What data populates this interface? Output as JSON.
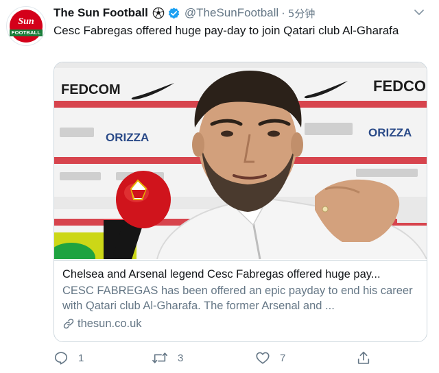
{
  "tweet": {
    "account": {
      "display_name": "The Sun Football",
      "emoji_icon": "soccer-ball-icon",
      "verified_icon": "verified-badge-icon",
      "handle": "@TheSunFootball",
      "separator": "·",
      "time": "5分钟",
      "avatar": {
        "logo_text": "Sun",
        "logo_subtext": "FOOTBALL",
        "brand_red": "#d4001a",
        "brand_green": "#1a7d3a"
      }
    },
    "text": "Cesc Fabregas offered huge pay-day to join Qatari club Al-Gharafa",
    "card": {
      "image_description_icon": "press-conference-photo",
      "title": "Chelsea and Arsenal legend Cesc Fabregas offered huge pay...",
      "description": "CESC FABREGAS has been offered an epic payday to end his career with Qatari club Al-Gharafa. The former Arsenal and ...",
      "domain": "thesun.co.uk",
      "sponsor_boards": [
        "FEDCOM",
        "FEDCO",
        "ORIZZA",
        "ORIZZA"
      ]
    },
    "actions": {
      "reply_count": "1",
      "retweet_count": "3",
      "like_count": "7"
    },
    "colors": {
      "text": "#14171a",
      "secondary": "#657786",
      "verified": "#1da1f2",
      "border": "#ccd6dd"
    }
  }
}
